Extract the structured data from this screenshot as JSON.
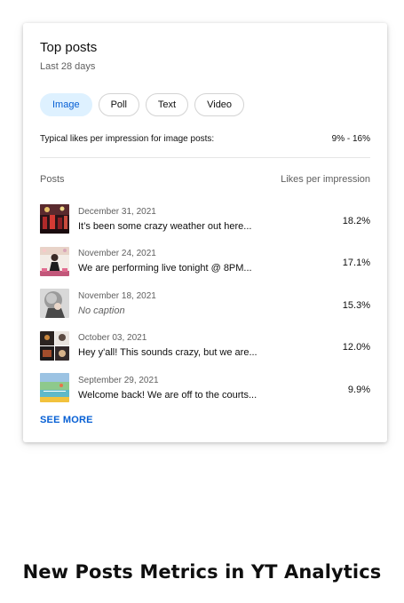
{
  "card": {
    "title": "Top posts",
    "subtitle": "Last 28 days",
    "chips": [
      {
        "label": "Image",
        "active": true
      },
      {
        "label": "Poll",
        "active": false
      },
      {
        "label": "Text",
        "active": false
      },
      {
        "label": "Video",
        "active": false
      }
    ],
    "typical_label": "Typical likes per impression for image posts:",
    "typical_value": "9% - 16%",
    "columns": {
      "posts": "Posts",
      "metric": "Likes per impression"
    },
    "posts": [
      {
        "thumbnail": "concert-crowd-thumbnail",
        "date": "December 31, 2021",
        "caption": "It’s been some crazy weather out here...",
        "value": "18.2%"
      },
      {
        "thumbnail": "stage-performer-thumbnail",
        "date": "November 24, 2021",
        "caption": "We are performing live tonight @ 8PM...",
        "value": "17.1%"
      },
      {
        "thumbnail": "portrait-thumbnail",
        "date": "November 18, 2021",
        "caption": "No caption",
        "value": "15.3%"
      },
      {
        "thumbnail": "photo-collage-thumbnail",
        "date": "October 03, 2021",
        "caption": "Hey y'all! This sounds crazy, but we are...",
        "value": "12.0%"
      },
      {
        "thumbnail": "tennis-court-thumbnail",
        "date": "September 29, 2021",
        "caption": "Welcome back! We are off to the courts...",
        "value": "9.9%"
      }
    ],
    "see_more": "SEE MORE"
  },
  "headline": "New Posts Metrics in YT Analytics",
  "colors": {
    "accent": "#065fd4",
    "chip_active_bg": "#def1ff",
    "secondary_text": "#606060"
  }
}
